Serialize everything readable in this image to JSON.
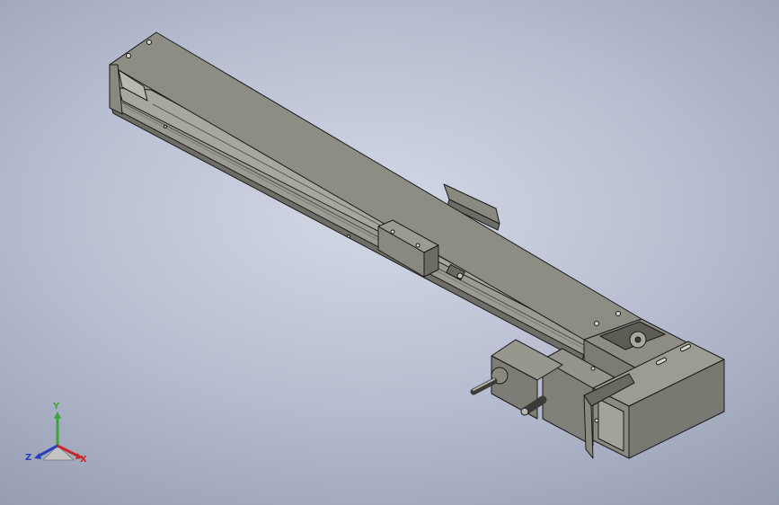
{
  "viewport": {
    "background_top": "#d3d8e6",
    "background_bottom": "#8c93a9",
    "model_name": "linear-actuator-module",
    "body_color": "#8e8d83",
    "edge_color": "#1a1a1a"
  },
  "triad": {
    "y_label": "Y",
    "z_label": "Z",
    "x_label": "X",
    "y_color": "#3aa63a",
    "z_color": "#2a3fb8",
    "x_color": "#c8282a"
  }
}
